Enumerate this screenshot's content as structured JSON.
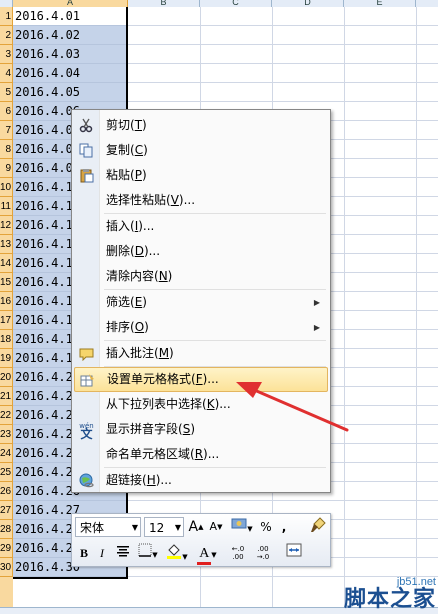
{
  "columns": [
    "A",
    "B",
    "C",
    "D",
    "E"
  ],
  "row_numbers": [
    "1",
    "2",
    "3",
    "4",
    "5",
    "6",
    "7",
    "8",
    "9",
    "10",
    "11",
    "12",
    "13",
    "14",
    "15",
    "16",
    "17",
    "18",
    "19",
    "20",
    "21",
    "22",
    "23",
    "24",
    "25",
    "26",
    "27",
    "28",
    "29",
    "30"
  ],
  "cells": [
    "2016.4.01",
    "2016.4.02",
    "2016.4.03",
    "2016.4.04",
    "2016.4.05",
    "2016.4.06",
    "2016.4.07",
    "2016.4.08",
    "2016.4.09",
    "2016.4.10",
    "2016.4.11",
    "2016.4.12",
    "2016.4.13",
    "2016.4.14",
    "2016.4.15",
    "2016.4.16",
    "2016.4.17",
    "2016.4.18",
    "2016.4.19",
    "2016.4.20",
    "2016.4.21",
    "2016.4.22",
    "2016.4.23",
    "2016.4.24",
    "2016.4.25",
    "2016.4.26",
    "2016.4.27",
    "2016.4.28",
    "2016.4.29",
    "2016.4.30"
  ],
  "context_menu": {
    "items": [
      {
        "label": "剪切(T)",
        "text": "剪切(",
        "key": "T",
        "end": ")",
        "icon": "scissors-icon"
      },
      {
        "label": "复制(C)",
        "text": "复制(",
        "key": "C",
        "end": ")",
        "icon": "copy-icon"
      },
      {
        "label": "粘贴(P)",
        "text": "粘贴(",
        "key": "P",
        "end": ")",
        "icon": "paste-icon"
      },
      {
        "label": "选择性粘贴(V)...",
        "text": "选择性粘贴(",
        "key": "V",
        "end": ")..."
      },
      {
        "label": "插入(I)...",
        "text": "插入(",
        "key": "I",
        "end": ")..."
      },
      {
        "label": "删除(D)...",
        "text": "删除(",
        "key": "D",
        "end": ")..."
      },
      {
        "label": "清除内容(N)",
        "text": "清除内容(",
        "key": "N",
        "end": ")"
      },
      {
        "label": "筛选(E)",
        "text": "筛选(",
        "key": "E",
        "end": ")"
      },
      {
        "label": "排序(O)",
        "text": "排序(",
        "key": "O",
        "end": ")"
      },
      {
        "label": "插入批注(M)",
        "text": "插入批注(",
        "key": "M",
        "end": ")",
        "icon": "comment-icon"
      },
      {
        "label": "设置单元格格式(F)...",
        "text": "设置单元格格式(",
        "key": "F",
        "end": ")...",
        "icon": "format-cells-icon"
      },
      {
        "label": "从下拉列表中选择(K)...",
        "text": "从下拉列表中选择(",
        "key": "K",
        "end": ")..."
      },
      {
        "label": "显示拼音字段(S)",
        "text": "显示拼音字段(",
        "key": "S",
        "end": ")",
        "icon": "phonetic-icon",
        "icon_text": "wén"
      },
      {
        "label": "命名单元格区域(R)...",
        "text": "命名单元格区域(",
        "key": "R",
        "end": ")..."
      },
      {
        "label": "超链接(H)...",
        "text": "超链接(",
        "key": "H",
        "end": ")...",
        "icon": "hyperlink-icon"
      }
    ],
    "highlighted_index": 10
  },
  "mini_toolbar": {
    "font_name": "宋体",
    "font_size": "12",
    "grow_font": "A",
    "shrink_font": "A",
    "percent": "%",
    "bold": "B",
    "italic": "I",
    "font_color_letter": "A",
    "decimal_increase": ".0 .00",
    "decimal_decrease": ".00 ➜.0"
  },
  "watermark": {
    "url": "jb51.net",
    "text": "脚本之家"
  },
  "colors": {
    "selection_fill": "#c5d3e9",
    "row_header_selected": "#f9d99f",
    "menu_highlight": "#fce298",
    "arrow_red": "#e03030",
    "font_color_bar": "#e02020",
    "fill_color_bar": "#ffff00"
  }
}
